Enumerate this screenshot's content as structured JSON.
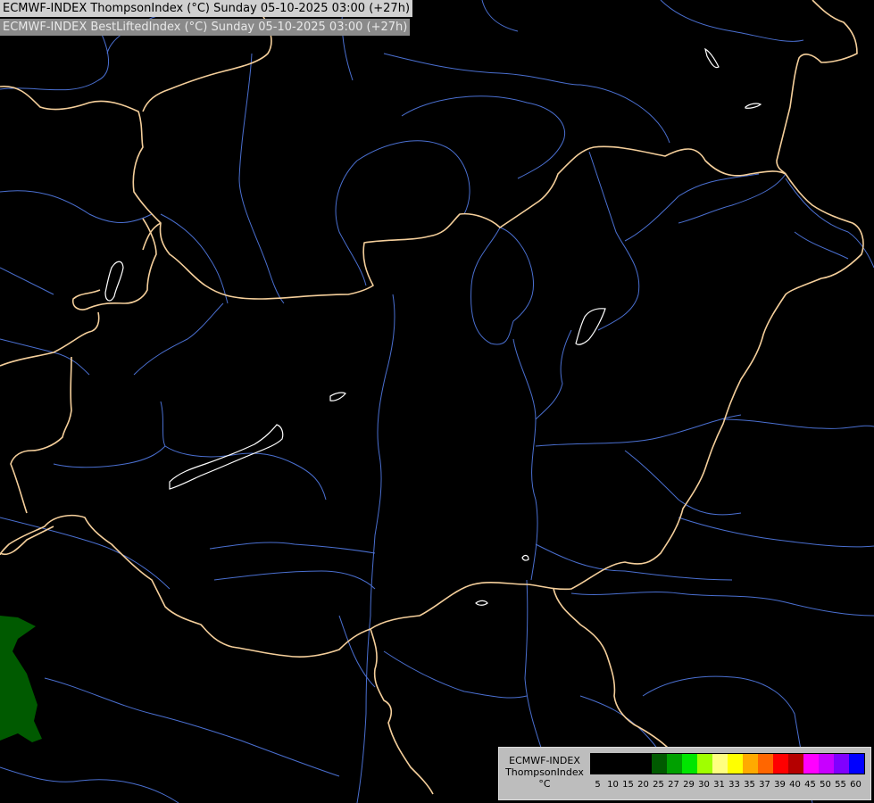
{
  "titles": {
    "line1": "ECMWF-INDEX ThompsonIndex (°C) Sunday 05-10-2025 03:00 (+27h)",
    "line2": "ECMWF-INDEX BestLiftedIndex (°C) Sunday 05-10-2025 03:00 (+27h)"
  },
  "legend": {
    "model": "ECMWF-INDEX",
    "parameter": "ThompsonIndex",
    "unit": "°C",
    "ticks": [
      "5",
      "10",
      "15",
      "20",
      "25",
      "27",
      "29",
      "30",
      "31",
      "33",
      "35",
      "37",
      "39",
      "40",
      "45",
      "50",
      "55",
      "60"
    ],
    "colors": [
      "#000000",
      "#000000",
      "#000000",
      "#000000",
      "#005a00",
      "#00a000",
      "#00e600",
      "#a0ff00",
      "#ffff80",
      "#ffff00",
      "#ffaa00",
      "#ff6600",
      "#ff0000",
      "#b40000",
      "#ff00ff",
      "#c800ff",
      "#8000ff",
      "#0000ff"
    ]
  },
  "map_colors": {
    "background": "#000000",
    "border": "#f5cf9b",
    "river": "#4a6fd0",
    "lake": "#ffffff",
    "field_low": "#005a00"
  }
}
